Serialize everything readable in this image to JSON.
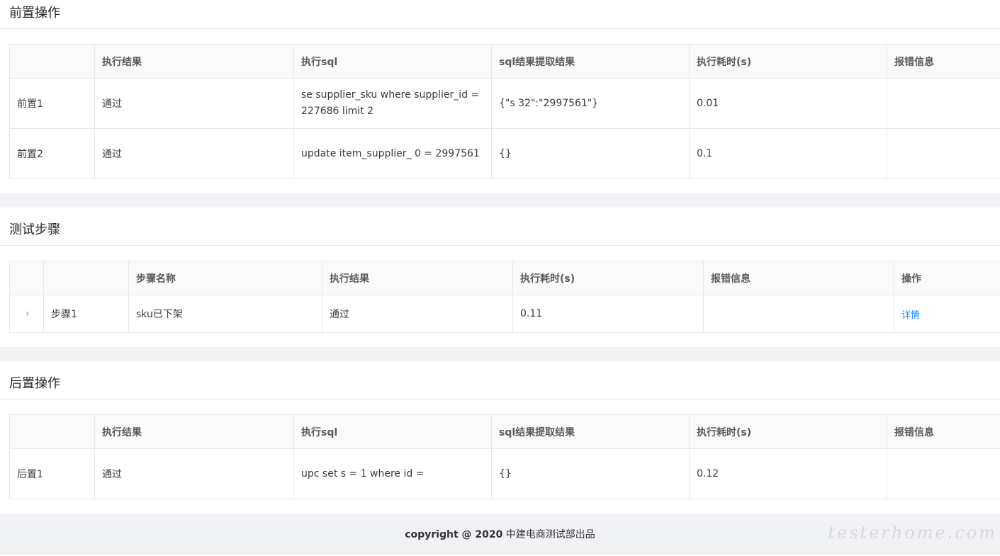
{
  "pre": {
    "title": "前置操作",
    "headers": [
      "",
      "执行结果",
      "执行sql",
      "sql结果提取结果",
      "执行耗时(s)",
      "报错信息"
    ],
    "rows": [
      {
        "name": "前置1",
        "result": "通过",
        "sql": "se                             supplier_sku where supplier_id = 227686 limit 2",
        "extract": "{\"s     32\":\"2997561\"}",
        "time": "0.01",
        "error": ""
      },
      {
        "name": "前置2",
        "result": "通过",
        "sql": "update item_supplier_  0          = 2997561",
        "extract": "{}",
        "time": "0.1",
        "error": ""
      }
    ]
  },
  "steps": {
    "title": "测试步骤",
    "headers": [
      "",
      "",
      "步骤名称",
      "执行结果",
      "执行耗时(s)",
      "报错信息",
      "操作"
    ],
    "rows": [
      {
        "expand": "›",
        "index": "步骤1",
        "name": "sku已下架",
        "result": "通过",
        "time": "0.11",
        "error": "",
        "action": "详情"
      }
    ]
  },
  "post": {
    "title": "后置操作",
    "headers": [
      "",
      "执行结果",
      "执行sql",
      "sql结果提取结果",
      "执行耗时(s)",
      "报错信息"
    ],
    "rows": [
      {
        "name": "后置1",
        "result": "通过",
        "sql": "upc          set       s = 1 where id = ",
        "extract": "{}",
        "time": "0.12",
        "error": ""
      }
    ]
  },
  "footer": {
    "bold": "copyright @ 2020",
    "text": " 中建电商测试部出品"
  },
  "watermark": "testerhome.com",
  "colors": {
    "pass": "#15c215",
    "link": "#1890ff",
    "gap": "#f0f2f5"
  }
}
